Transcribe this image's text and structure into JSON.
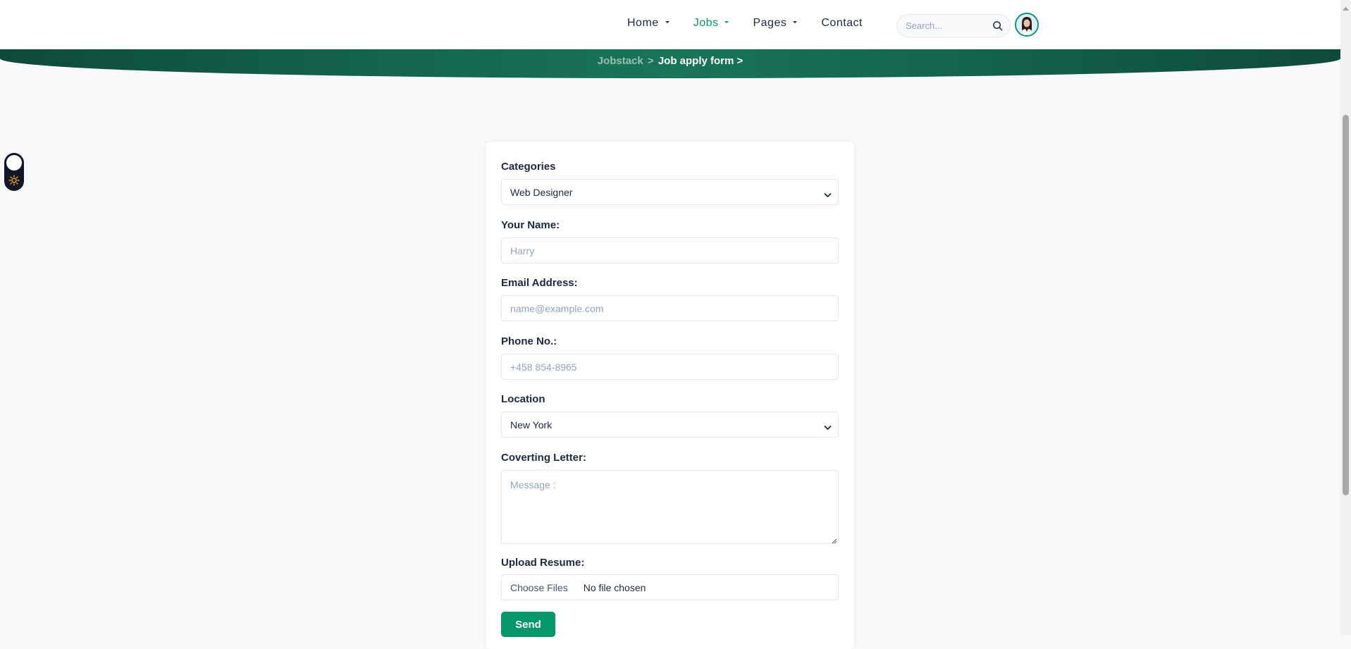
{
  "header": {
    "nav": [
      {
        "label": "Home",
        "active": false,
        "has_dropdown": true
      },
      {
        "label": "Jobs",
        "active": true,
        "has_dropdown": true
      },
      {
        "label": "Pages",
        "active": false,
        "has_dropdown": true
      },
      {
        "label": "Contact",
        "active": false,
        "has_dropdown": false
      }
    ],
    "search": {
      "placeholder": "Search...",
      "icon": "search-icon"
    },
    "avatar_icon": "user-avatar"
  },
  "hero": {
    "breadcrumb": {
      "home": "Jobstack",
      "separator": ">",
      "current": "Job apply form"
    }
  },
  "form": {
    "categories": {
      "label": "Categories",
      "selected": "Web Designer"
    },
    "name": {
      "label": "Your Name:",
      "placeholder": "Harry"
    },
    "email": {
      "label": "Email Address:",
      "placeholder": "name@example.com"
    },
    "phone": {
      "label": "Phone No.:",
      "placeholder": "+458 854-8965"
    },
    "location": {
      "label": "Location",
      "selected": "New York"
    },
    "letter": {
      "label": "Coverting Letter:",
      "placeholder": "Message :"
    },
    "resume": {
      "label": "Upload Resume:",
      "button": "Choose Files",
      "status": "No file chosen"
    },
    "submit": {
      "label": "Send"
    }
  },
  "colors": {
    "accent": "#059669",
    "hero": "#14654f",
    "text": "#1e293b",
    "page_bg": "#f8f9fa"
  }
}
